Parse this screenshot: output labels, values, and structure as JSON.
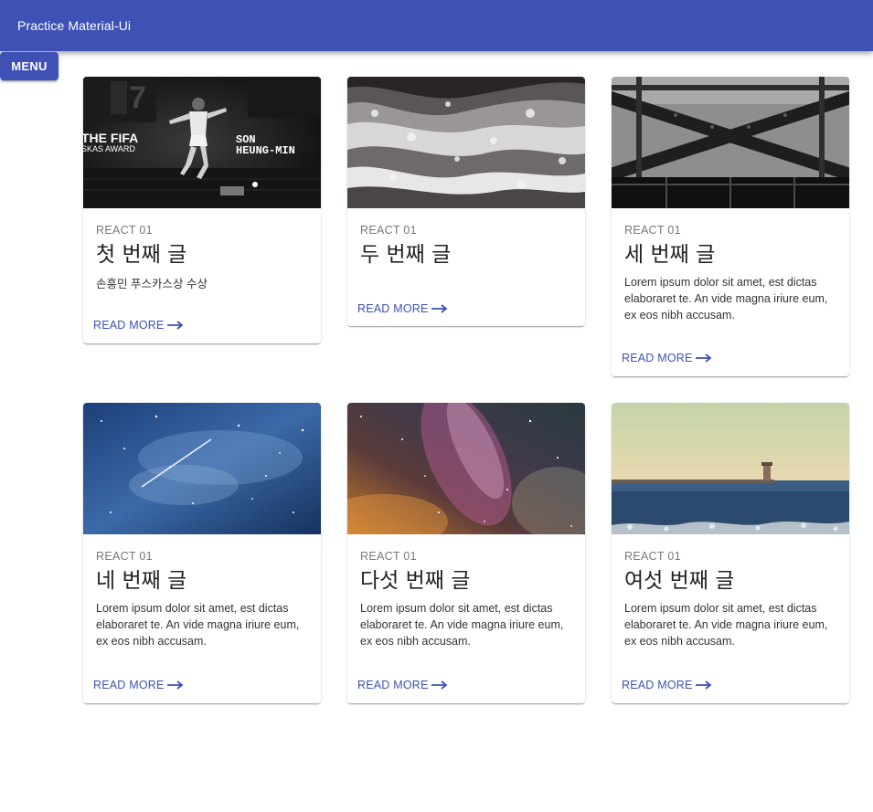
{
  "appbar": {
    "title": "Practice Material-Ui"
  },
  "menu_button": {
    "label": "MENU"
  },
  "cards": [
    {
      "overline": "REACT 01",
      "title": "첫 번째 글",
      "body": "손흥민 푸스카스상 수상",
      "action": "READ MORE",
      "image": {
        "alt": "soccer player photo",
        "banner_left": "THE FIFA",
        "banner_left_sub": "SKAS AWARD",
        "banner_right_1": "SON",
        "banner_right_2": "HEUNG-MIN",
        "jersey_number": "7"
      }
    },
    {
      "overline": "REACT 01",
      "title": "두 번째 글",
      "body": "",
      "action": "READ MORE",
      "image": {
        "alt": "ocean waves"
      }
    },
    {
      "overline": "REACT 01",
      "title": "세 번째 글",
      "body": "Lorem ipsum dolor sit amet, est dictas elaboraret te. An vide magna iriure eum, ex eos nibh accusam.",
      "action": "READ MORE",
      "image": {
        "alt": "steel bridge truss"
      }
    },
    {
      "overline": "REACT 01",
      "title": "네 번째 글",
      "body": "Lorem ipsum dolor sit amet, est dictas elaboraret te. An vide magna iriure eum, ex eos nibh accusam.",
      "action": "READ MORE",
      "image": {
        "alt": "blue starry sky with meteor"
      }
    },
    {
      "overline": "REACT 01",
      "title": "다섯 번째 글",
      "body": "Lorem ipsum dolor sit amet, est dictas elaboraret te. An vide magna iriure eum, ex eos nibh accusam.",
      "action": "READ MORE",
      "image": {
        "alt": "milky way galaxy"
      }
    },
    {
      "overline": "REACT 01",
      "title": "여섯 번째 글",
      "body": "Lorem ipsum dolor sit amet, est dictas elaboraret te. An vide magna iriure eum, ex eos nibh accusam.",
      "action": "READ MORE",
      "image": {
        "alt": "lighthouse pier at sea"
      }
    }
  ],
  "colors": {
    "primary": "#3f51b5",
    "text": "#222222",
    "secondary_text": "#777777",
    "background": "#ffffff"
  }
}
